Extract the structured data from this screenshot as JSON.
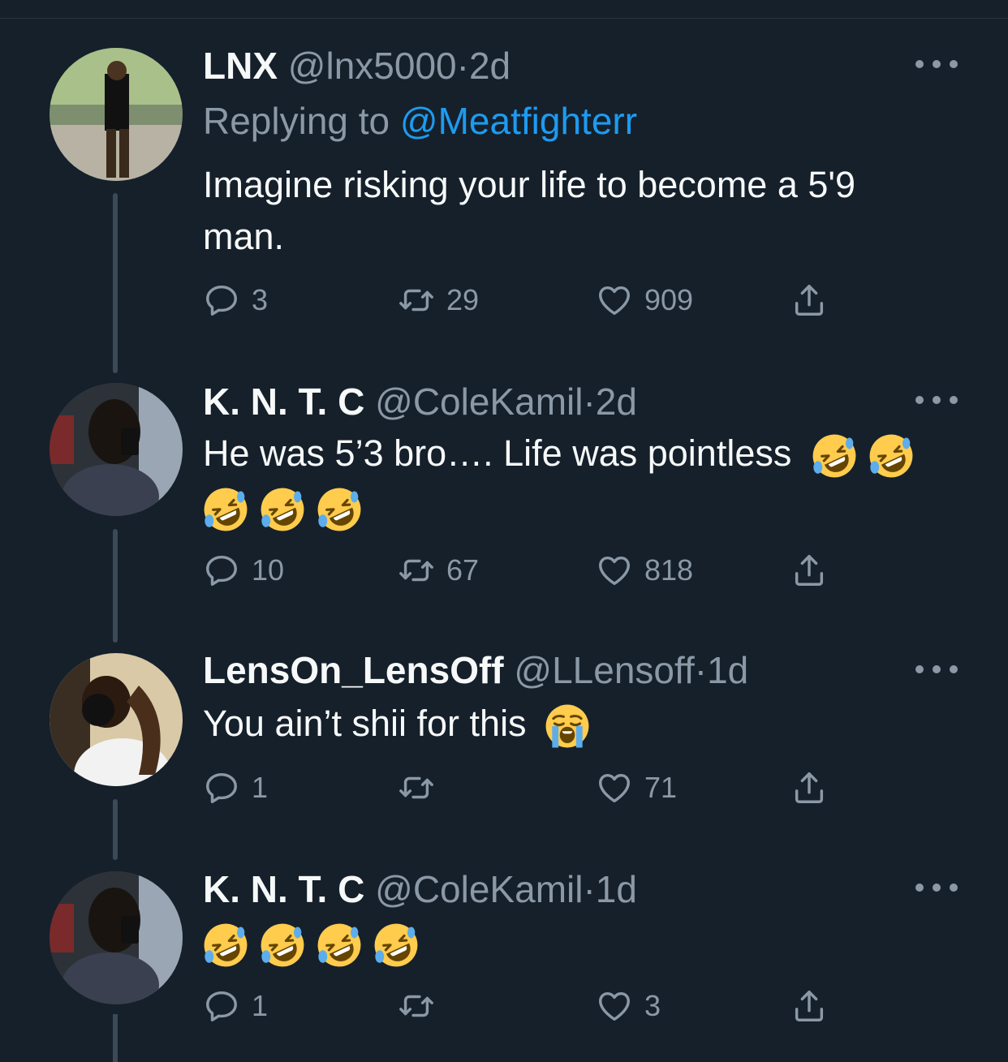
{
  "tweets": [
    {
      "name": "LNX",
      "handle": "@lnx5000",
      "dot": "·",
      "time": "2d",
      "replying_prefix": "Replying to",
      "replying_mention": "@Meatfighterr",
      "text": "Imagine risking your life to become a 5'9 man.",
      "replies": "3",
      "retweets": "29",
      "likes": "909"
    },
    {
      "name": "K. N. T. C",
      "handle": "@ColeKamil",
      "dot": "·",
      "time": "2d",
      "text": "He was 5’3 bro…. Life was pointless",
      "emojis": [
        "rolling-on-floor-laughing",
        "rolling-on-floor-laughing",
        "rolling-on-floor-laughing",
        "rolling-on-floor-laughing",
        "rolling-on-floor-laughing"
      ],
      "replies": "10",
      "retweets": "67",
      "likes": "818"
    },
    {
      "name": "LensOn_LensOff",
      "handle": "@LLensoff",
      "dot": "·",
      "time": "1d",
      "text": "You ain’t shii for this",
      "emojis": [
        "loudly-crying-face"
      ],
      "replies": "1",
      "retweets": "",
      "likes": "71"
    },
    {
      "name": "K. N. T. C",
      "handle": "@ColeKamil",
      "dot": "·",
      "time": "1d",
      "text": "",
      "emojis": [
        "rolling-on-floor-laughing",
        "rolling-on-floor-laughing",
        "rolling-on-floor-laughing",
        "rolling-on-floor-laughing"
      ],
      "replies": "1",
      "retweets": "",
      "likes": "3"
    }
  ],
  "colors": {
    "background": "#15202b",
    "secondary_text": "#8b98a5",
    "link": "#1d9bf0",
    "primary_text": "#f7f9f9"
  },
  "icons": {
    "reply": "reply-icon",
    "retweet": "retweet-icon",
    "like": "heart-icon",
    "share": "share-icon",
    "more": "more-icon"
  }
}
